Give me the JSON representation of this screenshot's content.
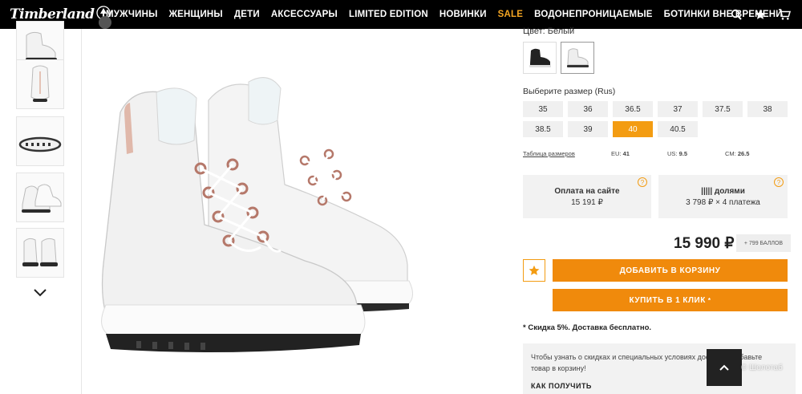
{
  "header": {
    "logo_text": "Timberland",
    "nav": [
      "МУЖЧИНЫ",
      "ЖЕНЩИНЫ",
      "ДЕТИ",
      "АКСЕССУАРЫ",
      "LIMITED EDITION",
      "НОВИНКИ",
      "SALE",
      "ВОДОНЕПРОНИЦАЕМЫЕ",
      "БОТИНКИ ВНЕ ВРЕМЕНИ"
    ],
    "icons": [
      "search-icon",
      "star-icon",
      "cart-icon"
    ]
  },
  "gallery": {
    "thumbnails": [
      "boot-side",
      "boot-back",
      "sole-bottom",
      "boot-pair-angle",
      "boot-pair-front"
    ],
    "next_icon": "chevron-down-icon"
  },
  "product": {
    "color_label": "Цвет: Белый",
    "swatches": [
      "black",
      "white"
    ],
    "size_label": "Выберите размер (Rus)",
    "sizes": [
      "35",
      "36",
      "36.5",
      "37",
      "37.5",
      "38",
      "38.5",
      "39",
      "40",
      "40.5"
    ],
    "selected_size": "40",
    "size_table_link": "Таблица размеров",
    "eu_label": "EU:",
    "eu_value": "41",
    "us_label": "US:",
    "us_value": "9.5",
    "cm_label": "CM:",
    "cm_value": "26.5",
    "pay_site_title": "Оплата на сайте",
    "pay_site_value": "15 191 ₽",
    "installments_title": "||||| долями",
    "installments_value": "3 798 ₽ × 4 платежа",
    "price": "15 990 ₽",
    "bonus": "+ 799 БАЛЛОВ",
    "add_to_cart": "ДОБАВИТЬ В КОРЗИНУ",
    "buy_one_click": "КУПИТЬ В 1 КЛИК",
    "buy_one_click_mark": "*",
    "promo": "* Скидка 5%. Доставка бесплатно.",
    "info_text": "Чтобы узнать о скидках и специальных условиях доставки, добавьте товар в корзину!",
    "info_link": "КАК ПОЛУЧИТЬ",
    "watermark": "© Шолотаб"
  },
  "colors": {
    "accent": "#f08a0c",
    "selected_size": "#f39c12",
    "header_bg": "#000000"
  }
}
